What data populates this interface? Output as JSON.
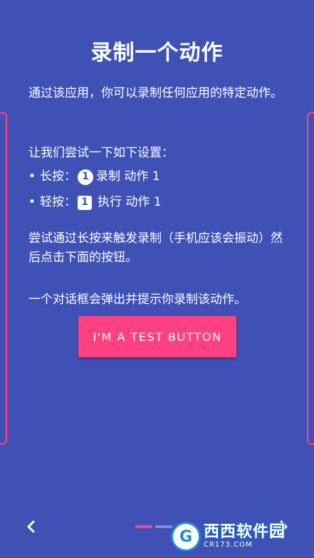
{
  "title": "录制一个动作",
  "intro": "通过该应用，你可以录制任何应用的特定动作。",
  "setup_heading": "让我们尝试一下如下设置：",
  "bullets": [
    {
      "dot": "•",
      "label": "长按：",
      "badge": "1",
      "action": "录制 动作 1"
    },
    {
      "dot": "•",
      "label": "轻按：",
      "badge": "1",
      "action": "执行 动作 1"
    }
  ],
  "instruction": "尝试通过长按来触发录制（手机应该会振动）然后点击下面的按钮。",
  "dialog_note": "一个对话框会弹出并提示你录制该动作。",
  "test_button_label": "I'M A TEST BUTTON",
  "nav": {
    "prev_icon": "chevron-left-icon",
    "next_icon": "chevron-right-icon"
  },
  "page_indicator": {
    "count": 2,
    "active": 0
  },
  "watermark": {
    "logo": "G",
    "title": "西西软件园",
    "sub": "CR173.COM"
  },
  "colors": {
    "background": "#3f51b5",
    "accent": "#ff4081",
    "text": "#ffffff"
  }
}
